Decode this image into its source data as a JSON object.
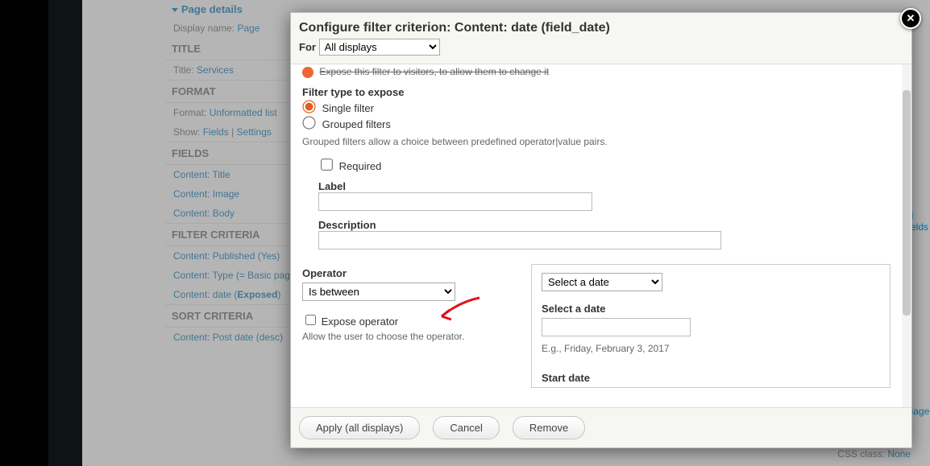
{
  "page_details": {
    "header": "Page details",
    "display_label": "Display name:",
    "display_value": "Page"
  },
  "sections": {
    "title_hdr": "TITLE",
    "title_row_lbl": "Title:",
    "title_row_val": "Services",
    "format_hdr": "FORMAT",
    "format_lbl": "Format:",
    "format_val": "Unformatted list",
    "show_lbl": "Show:",
    "show_val": "Fields",
    "show_sep": "|",
    "show_settings": "Settings",
    "fields_hdr": "FIELDS",
    "field_1": "Content: Title",
    "field_2": "Content: Image",
    "field_3": "Content: Body",
    "filter_hdr": "FILTER CRITERIA",
    "filter_1": "Content: Published (Yes)",
    "filter_2": "Content: Type (= Basic page)",
    "filter_3a": "Content: date (",
    "filter_3b": "Exposed",
    "filter_3c": ")",
    "sort_hdr": "SORT CRITERIA",
    "sort_1": "Content: Post date (desc)"
  },
  "right_frags": {
    "f1": "ed Fields",
    "f2": "guage",
    "f3": "None"
  },
  "right_extra_lbl": "CSS class:",
  "modal": {
    "title": "Configure filter criterion: Content: date (field_date)",
    "for_lbl": "For",
    "for_value": "All displays",
    "expose_cutoff": "Expose this filter to visitors, to allow them to change it",
    "filter_type_hdr": "Filter type to expose",
    "radio_single": "Single filter",
    "radio_grouped": "Grouped filters",
    "grouped_desc": "Grouped filters allow a choice between predefined operator|value pairs.",
    "required_lbl": "Required",
    "label_lbl": "Label",
    "label_val": "",
    "desc_lbl": "Description",
    "desc_val": "",
    "operator_lbl": "Operator",
    "operator_val": "Is between",
    "expose_op_lbl": "Expose operator",
    "expose_op_desc": "Allow the user to choose the operator.",
    "select_date_opt": "Select a date",
    "select_date_lbl": "Select a date",
    "select_date_val": "",
    "eg_text": "E.g., Friday, February 3, 2017",
    "start_date_lbl": "Start date"
  },
  "buttons": {
    "apply": "Apply (all displays)",
    "cancel": "Cancel",
    "remove": "Remove"
  }
}
